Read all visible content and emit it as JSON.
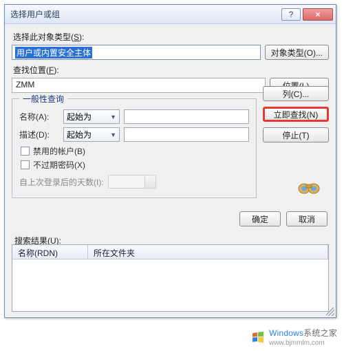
{
  "window": {
    "title": "选择用户或组",
    "help_label": "?",
    "close_label": "×"
  },
  "object_type": {
    "label_prefix": "选择此对象类型(",
    "label_hotkey": "S",
    "label_suffix": "):",
    "value": "用户或内置安全主体",
    "button": "对象类型(O)..."
  },
  "location": {
    "label_prefix": "查找位置(",
    "label_hotkey": "F",
    "label_suffix": "):",
    "value": "ZMM",
    "button": "位置(L)..."
  },
  "group": {
    "legend": "一般性查询",
    "name": {
      "label": "名称(A):",
      "starts_with": "起始为"
    },
    "desc": {
      "label": "描述(D):",
      "starts_with": "起始为"
    },
    "disabled_accounts": "禁用的帐户(B)",
    "no_expire_pw": "不过期密码(X)",
    "days_since_login": "自上次登录后的天数(I):"
  },
  "buttons": {
    "columns": "列(C)...",
    "find_now": "立即查找(N)",
    "stop": "停止(T)",
    "ok": "确定",
    "cancel": "取消"
  },
  "results": {
    "label": "搜索结果(U):",
    "col1": "名称(RDN)",
    "col2": "所在文件夹"
  },
  "watermark": {
    "brand_win": "Windows",
    "brand_rest": "系统之家",
    "url": "www.bjmmlm.com"
  }
}
